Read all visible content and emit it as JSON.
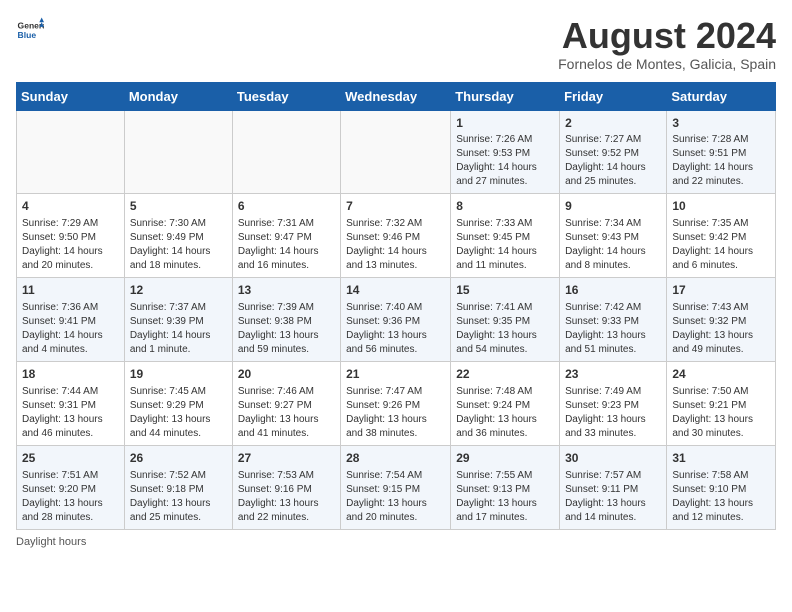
{
  "header": {
    "logo": {
      "general": "General",
      "blue": "Blue"
    },
    "title": "August 2024",
    "location": "Fornelos de Montes, Galicia, Spain"
  },
  "days_of_week": [
    "Sunday",
    "Monday",
    "Tuesday",
    "Wednesday",
    "Thursday",
    "Friday",
    "Saturday"
  ],
  "weeks": [
    [
      {
        "day": "",
        "info": ""
      },
      {
        "day": "",
        "info": ""
      },
      {
        "day": "",
        "info": ""
      },
      {
        "day": "",
        "info": ""
      },
      {
        "day": "1",
        "info": "Sunrise: 7:26 AM\nSunset: 9:53 PM\nDaylight: 14 hours and 27 minutes."
      },
      {
        "day": "2",
        "info": "Sunrise: 7:27 AM\nSunset: 9:52 PM\nDaylight: 14 hours and 25 minutes."
      },
      {
        "day": "3",
        "info": "Sunrise: 7:28 AM\nSunset: 9:51 PM\nDaylight: 14 hours and 22 minutes."
      }
    ],
    [
      {
        "day": "4",
        "info": "Sunrise: 7:29 AM\nSunset: 9:50 PM\nDaylight: 14 hours and 20 minutes."
      },
      {
        "day": "5",
        "info": "Sunrise: 7:30 AM\nSunset: 9:49 PM\nDaylight: 14 hours and 18 minutes."
      },
      {
        "day": "6",
        "info": "Sunrise: 7:31 AM\nSunset: 9:47 PM\nDaylight: 14 hours and 16 minutes."
      },
      {
        "day": "7",
        "info": "Sunrise: 7:32 AM\nSunset: 9:46 PM\nDaylight: 14 hours and 13 minutes."
      },
      {
        "day": "8",
        "info": "Sunrise: 7:33 AM\nSunset: 9:45 PM\nDaylight: 14 hours and 11 minutes."
      },
      {
        "day": "9",
        "info": "Sunrise: 7:34 AM\nSunset: 9:43 PM\nDaylight: 14 hours and 8 minutes."
      },
      {
        "day": "10",
        "info": "Sunrise: 7:35 AM\nSunset: 9:42 PM\nDaylight: 14 hours and 6 minutes."
      }
    ],
    [
      {
        "day": "11",
        "info": "Sunrise: 7:36 AM\nSunset: 9:41 PM\nDaylight: 14 hours and 4 minutes."
      },
      {
        "day": "12",
        "info": "Sunrise: 7:37 AM\nSunset: 9:39 PM\nDaylight: 14 hours and 1 minute."
      },
      {
        "day": "13",
        "info": "Sunrise: 7:39 AM\nSunset: 9:38 PM\nDaylight: 13 hours and 59 minutes."
      },
      {
        "day": "14",
        "info": "Sunrise: 7:40 AM\nSunset: 9:36 PM\nDaylight: 13 hours and 56 minutes."
      },
      {
        "day": "15",
        "info": "Sunrise: 7:41 AM\nSunset: 9:35 PM\nDaylight: 13 hours and 54 minutes."
      },
      {
        "day": "16",
        "info": "Sunrise: 7:42 AM\nSunset: 9:33 PM\nDaylight: 13 hours and 51 minutes."
      },
      {
        "day": "17",
        "info": "Sunrise: 7:43 AM\nSunset: 9:32 PM\nDaylight: 13 hours and 49 minutes."
      }
    ],
    [
      {
        "day": "18",
        "info": "Sunrise: 7:44 AM\nSunset: 9:31 PM\nDaylight: 13 hours and 46 minutes."
      },
      {
        "day": "19",
        "info": "Sunrise: 7:45 AM\nSunset: 9:29 PM\nDaylight: 13 hours and 44 minutes."
      },
      {
        "day": "20",
        "info": "Sunrise: 7:46 AM\nSunset: 9:27 PM\nDaylight: 13 hours and 41 minutes."
      },
      {
        "day": "21",
        "info": "Sunrise: 7:47 AM\nSunset: 9:26 PM\nDaylight: 13 hours and 38 minutes."
      },
      {
        "day": "22",
        "info": "Sunrise: 7:48 AM\nSunset: 9:24 PM\nDaylight: 13 hours and 36 minutes."
      },
      {
        "day": "23",
        "info": "Sunrise: 7:49 AM\nSunset: 9:23 PM\nDaylight: 13 hours and 33 minutes."
      },
      {
        "day": "24",
        "info": "Sunrise: 7:50 AM\nSunset: 9:21 PM\nDaylight: 13 hours and 30 minutes."
      }
    ],
    [
      {
        "day": "25",
        "info": "Sunrise: 7:51 AM\nSunset: 9:20 PM\nDaylight: 13 hours and 28 minutes."
      },
      {
        "day": "26",
        "info": "Sunrise: 7:52 AM\nSunset: 9:18 PM\nDaylight: 13 hours and 25 minutes."
      },
      {
        "day": "27",
        "info": "Sunrise: 7:53 AM\nSunset: 9:16 PM\nDaylight: 13 hours and 22 minutes."
      },
      {
        "day": "28",
        "info": "Sunrise: 7:54 AM\nSunset: 9:15 PM\nDaylight: 13 hours and 20 minutes."
      },
      {
        "day": "29",
        "info": "Sunrise: 7:55 AM\nSunset: 9:13 PM\nDaylight: 13 hours and 17 minutes."
      },
      {
        "day": "30",
        "info": "Sunrise: 7:57 AM\nSunset: 9:11 PM\nDaylight: 13 hours and 14 minutes."
      },
      {
        "day": "31",
        "info": "Sunrise: 7:58 AM\nSunset: 9:10 PM\nDaylight: 13 hours and 12 minutes."
      }
    ]
  ],
  "footer": {
    "daylight_label": "Daylight hours"
  }
}
